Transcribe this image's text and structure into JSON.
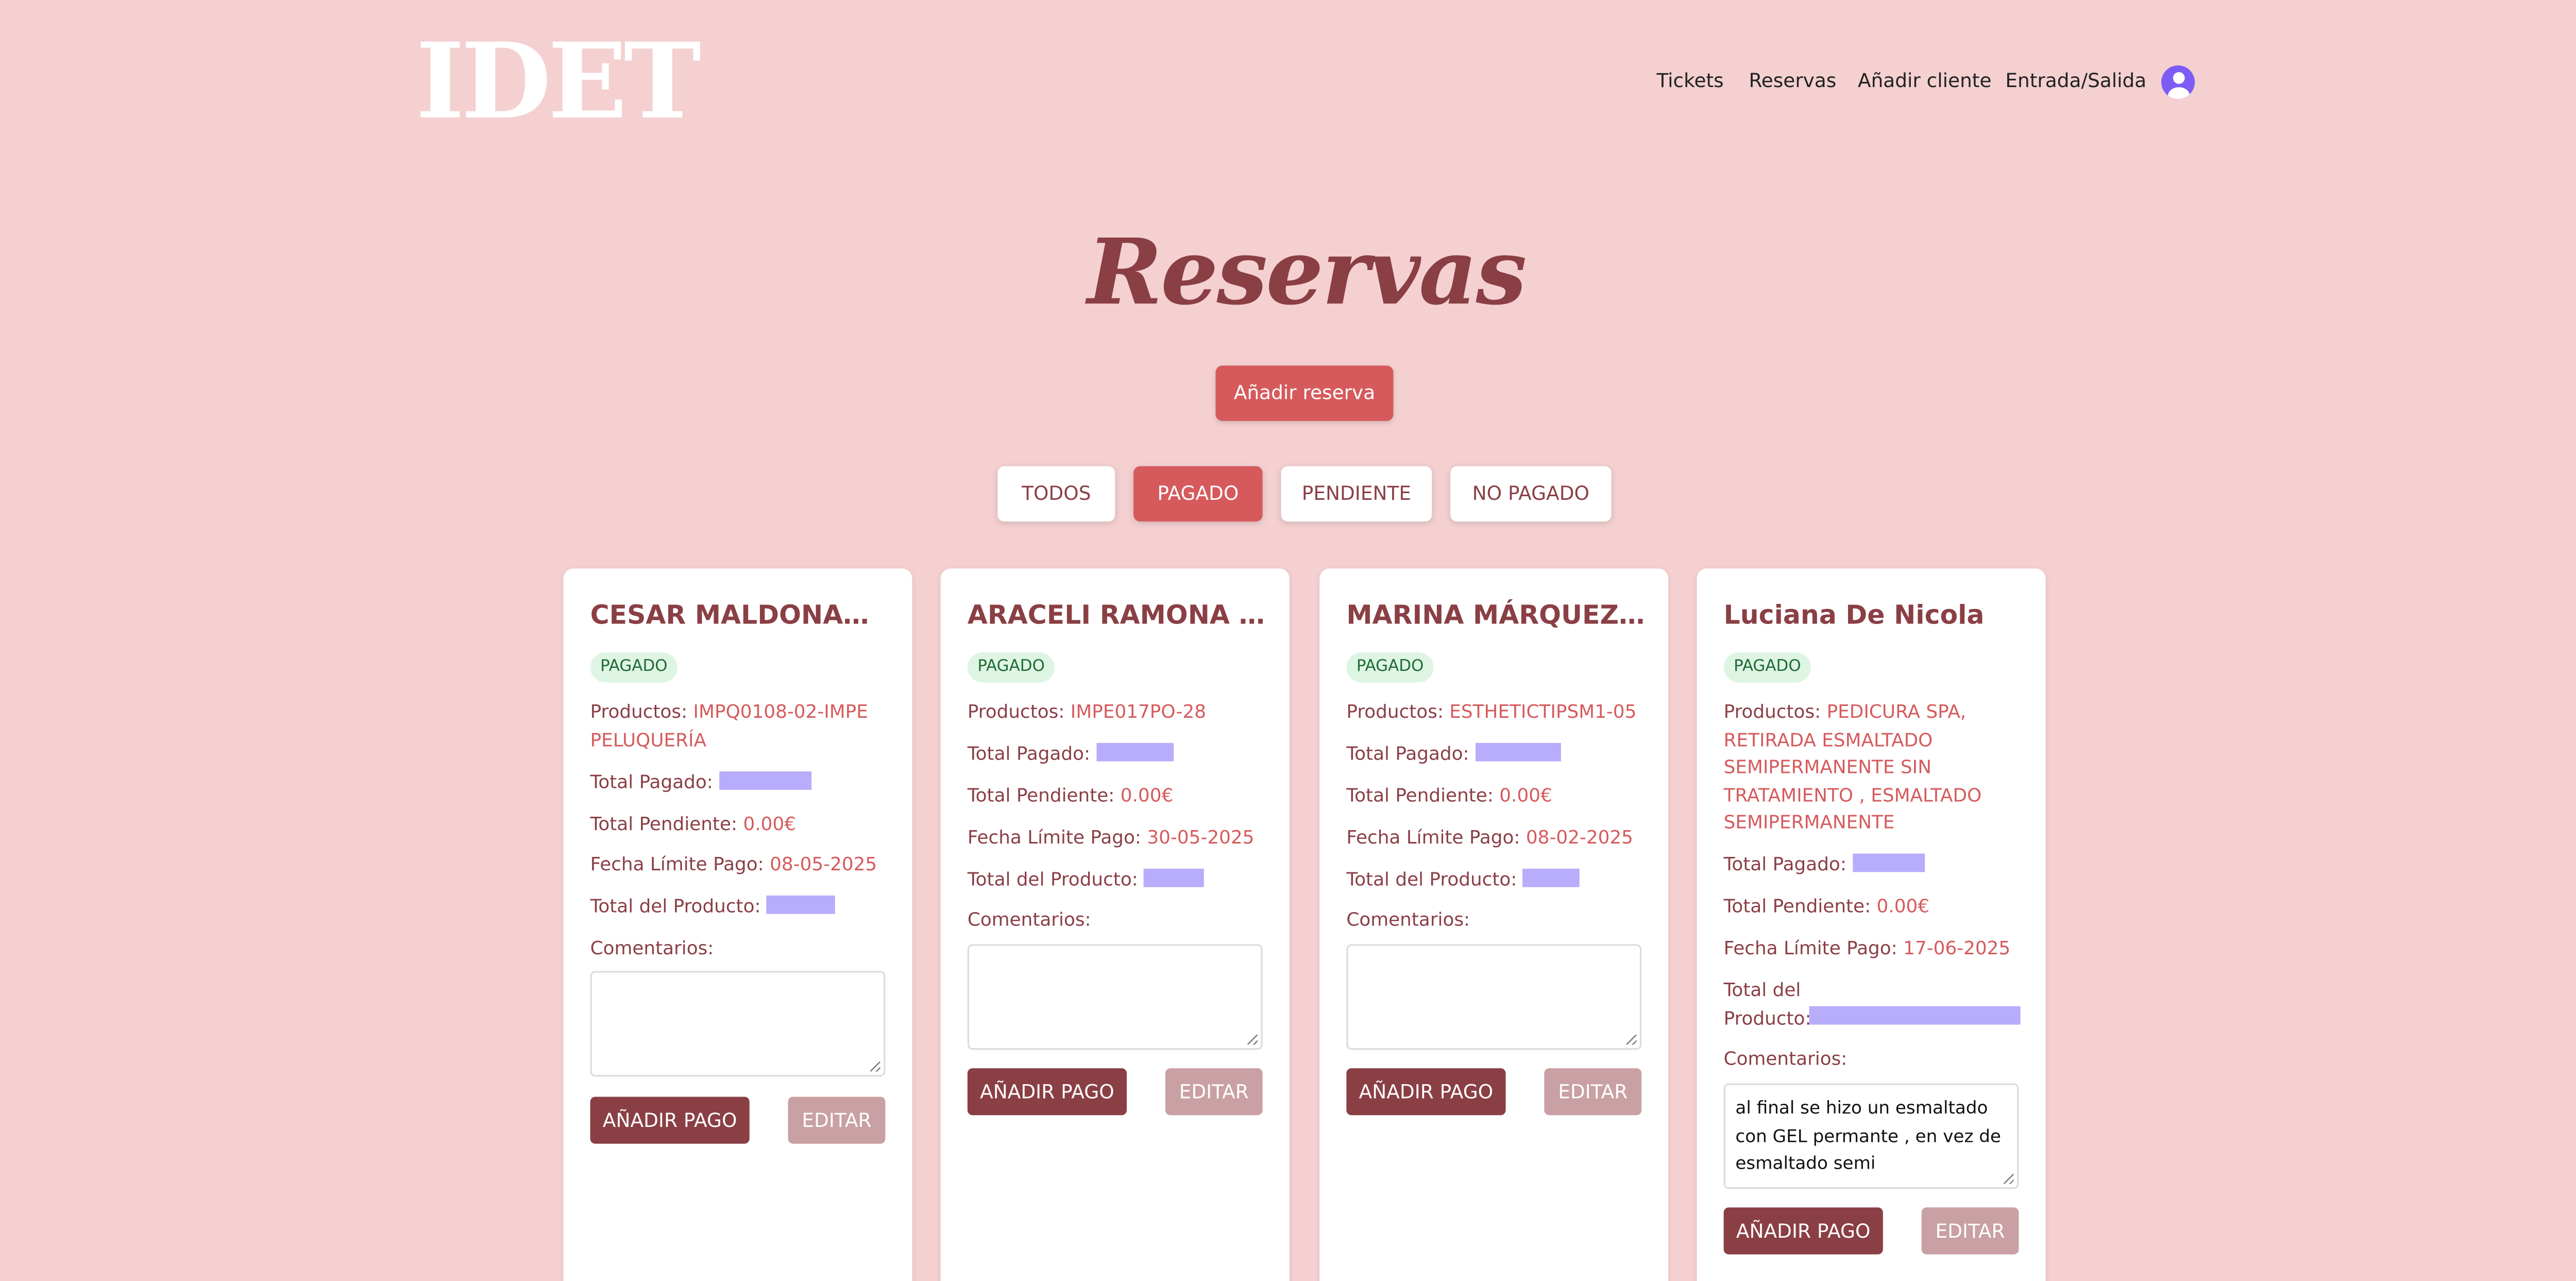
{
  "brand": {
    "logo": "IDET"
  },
  "nav": {
    "items": [
      {
        "label": "Tickets"
      },
      {
        "label": "Reservas"
      },
      {
        "label": "Añadir cliente"
      },
      {
        "label": "Entrada/Salida"
      }
    ]
  },
  "page": {
    "title": "Reservas",
    "add_button": "Añadir reserva"
  },
  "filters": [
    {
      "label": "TODOS",
      "active": false
    },
    {
      "label": "PAGADO",
      "active": true
    },
    {
      "label": "PENDIENTE",
      "active": false
    },
    {
      "label": "NO PAGADO",
      "active": false
    }
  ],
  "labels": {
    "productos": "Productos:",
    "total_pagado": "Total Pagado:",
    "total_pendiente": "Total Pendiente:",
    "fecha_limite": "Fecha Límite Pago:",
    "total_producto": "Total del Producto:",
    "comentarios": "Comentarios:",
    "add_payment": "AÑADIR PAGO",
    "edit": "EDITAR"
  },
  "cards": [
    {
      "name": "CESAR MALDONADO...",
      "status": "PAGADO",
      "productos": "IMPQ0108-02-IMPE PELUQUERÍA",
      "total_pendiente": "0.00€",
      "fecha_limite": "08-05-2025",
      "comentario": ""
    },
    {
      "name": "ARACELI RAMONA G...",
      "status": "PAGADO",
      "productos": "IMPE017PO-28",
      "total_pendiente": "0.00€",
      "fecha_limite": "30-05-2025",
      "comentario": ""
    },
    {
      "name": "MARINA MÁRQUEZ R...",
      "status": "PAGADO",
      "productos": "ESTHETICTIPSM1-05",
      "total_pendiente": "0.00€",
      "fecha_limite": "08-02-2025",
      "comentario": ""
    },
    {
      "name": "Luciana De Nicola",
      "status": "PAGADO",
      "productos": "PEDICURA SPA, RETIRADA ESMALTADO SEMIPERMANENTE SIN TRATAMIENTO , ESMALTADO SEMIPERMANENTE",
      "total_pendiente": "0.00€",
      "fecha_limite": "17-06-2025",
      "comentario": "al final se hizo un esmaltado con GEL permante , en vez de esmaltado semi"
    }
  ],
  "colors": {
    "background": "#f4d0d1",
    "accent": "#d65a5c",
    "primary_dark": "#8a3f45",
    "badge_bg": "#dff5e4",
    "redaction": "#b7adfb"
  }
}
